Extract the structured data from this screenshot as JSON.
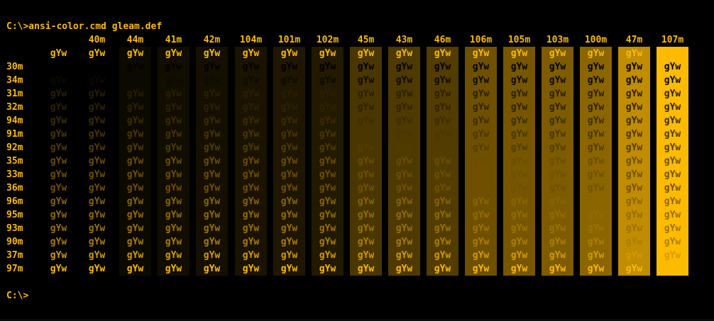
{
  "terminal": {
    "command_line": "C:\\>ansi-color.cmd gleam.def",
    "prompt": "C:\\>",
    "sample_text": "gYw",
    "background_color": "#000000",
    "text_color": "#fdbb00"
  },
  "table": {
    "column_headers": [
      "",
      "40m",
      "44m",
      "41m",
      "42m",
      "104m",
      "101m",
      "102m",
      "45m",
      "43m",
      "46m",
      "106m",
      "105m",
      "103m",
      "100m",
      "47m",
      "107m"
    ],
    "row_headers": [
      "",
      "30m",
      "34m",
      "31m",
      "32m",
      "94m",
      "91m",
      "92m",
      "35m",
      "33m",
      "36m",
      "96m",
      "95m",
      "93m",
      "90m",
      "37m",
      "97m"
    ],
    "background_colors": [
      "#000000",
      "#000000",
      "#0c0a00",
      "#110d00",
      "#140f00",
      "#1a1300",
      "#1e1600",
      "#221900",
      "#4a3600",
      "#4e3900",
      "#533c00",
      "#6e5000",
      "#765600",
      "#7d5b00",
      "#8a6500",
      "#c08c00",
      "#fdbb00"
    ],
    "foreground_colors": [
      "#fdbb00",
      "#000000",
      "#0c0a00",
      "#2a1f00",
      "#2e2200",
      "#3c2c00",
      "#4a3600",
      "#523c00",
      "#6b4e00",
      "#6e5000",
      "#744f00",
      "#8a6500",
      "#946c00",
      "#9c7200",
      "#ad7e00",
      "#d49b00",
      "#fdbb00"
    ]
  }
}
